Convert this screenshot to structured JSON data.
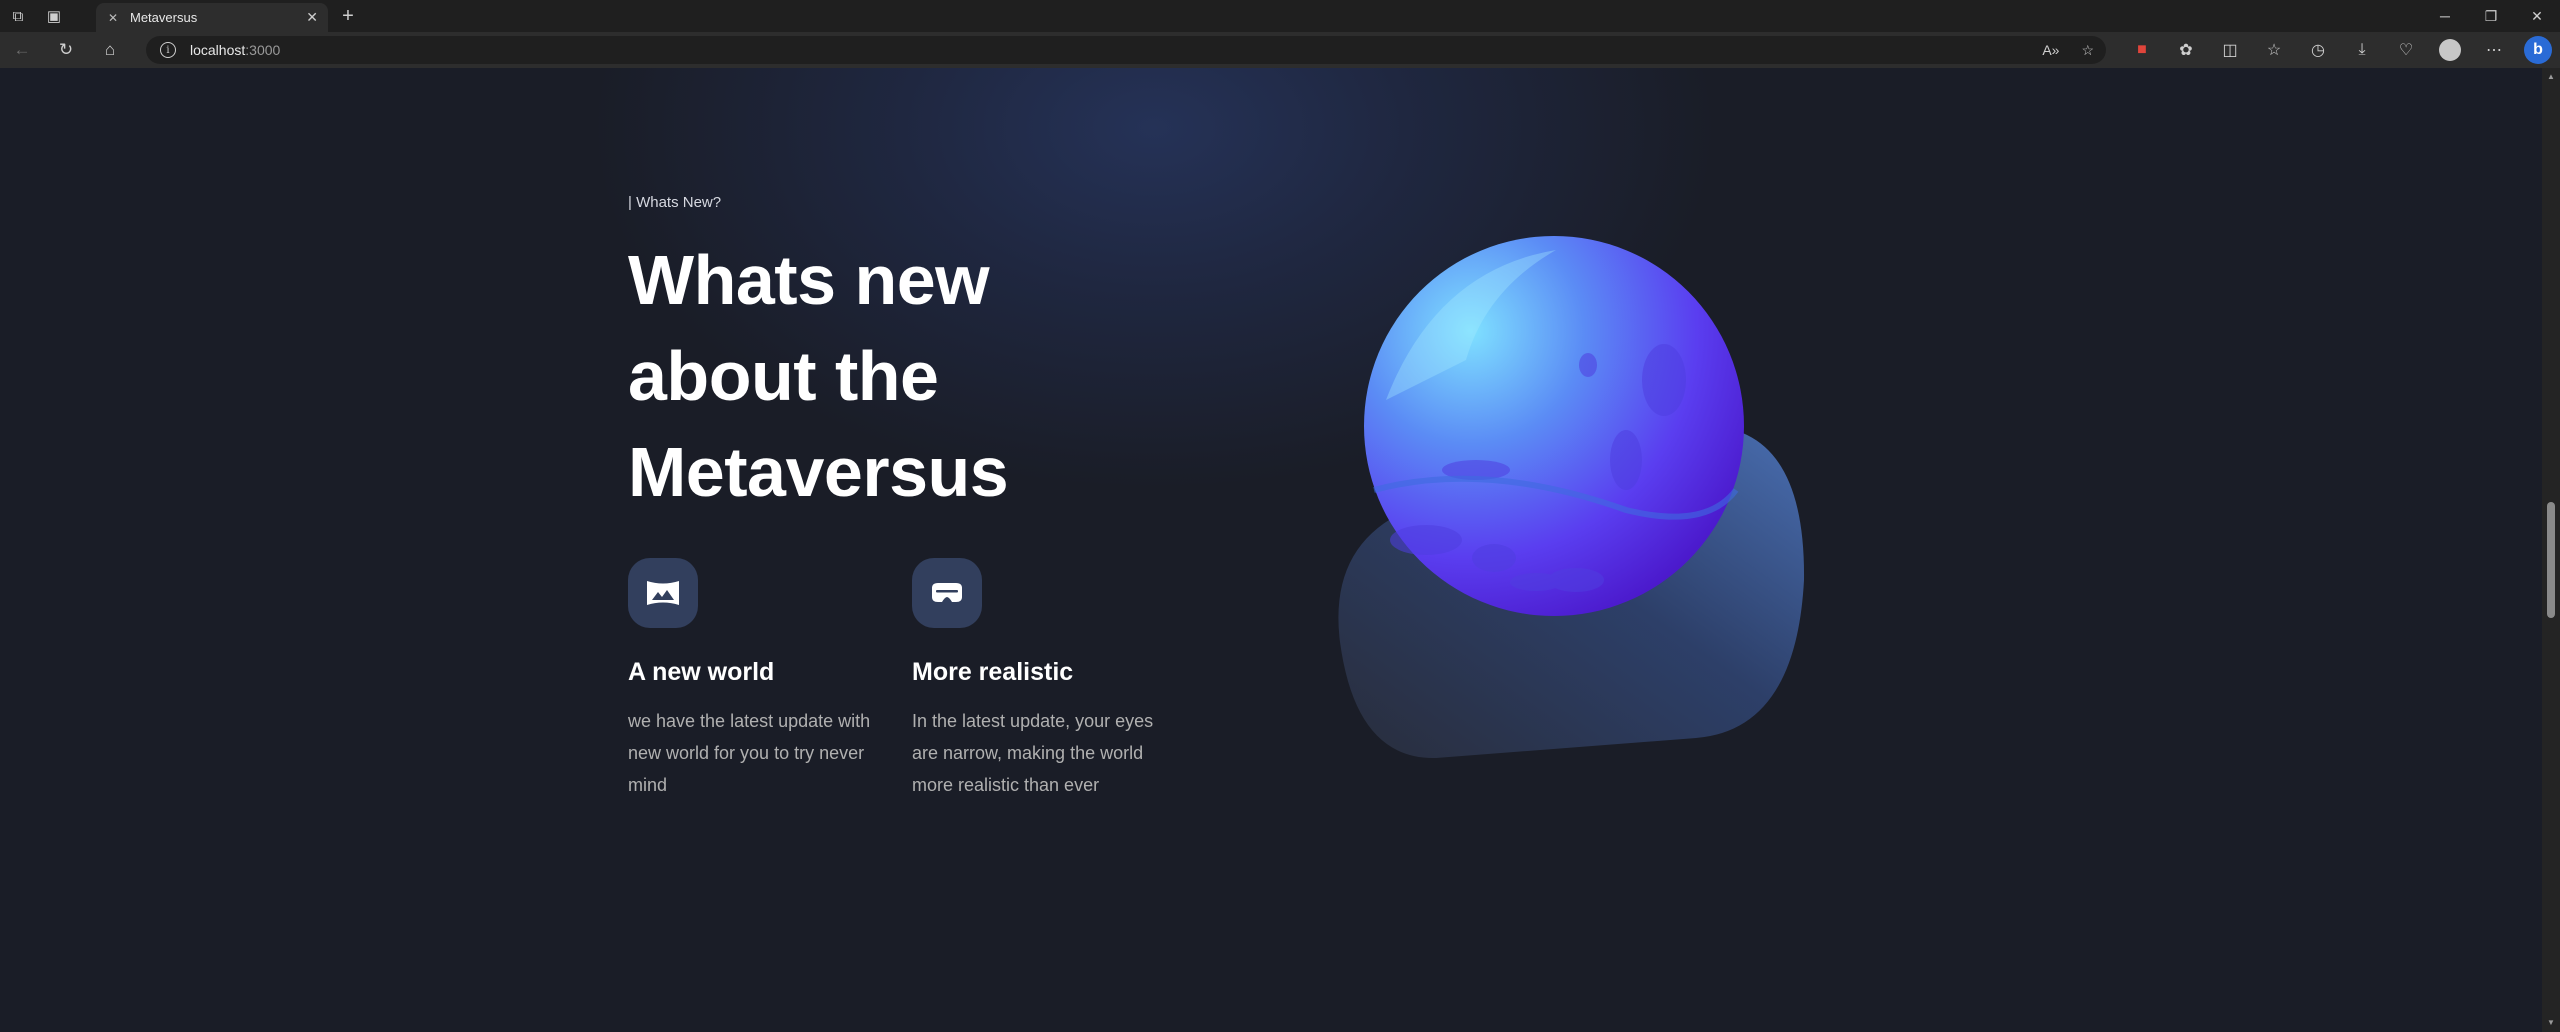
{
  "browser": {
    "tab_title": "Metaversus",
    "address_host": "localhost",
    "address_port": ":3000"
  },
  "section": {
    "eyebrow": "| Whats New?",
    "headline_line1": "Whats new",
    "headline_line2": "about the",
    "headline_line3": "Metaversus"
  },
  "features": [
    {
      "icon": "landscape-icon",
      "title": "A new world",
      "body": "we have the latest update with new world for you to try never mind"
    },
    {
      "icon": "vr-headset-icon",
      "title": "More realistic",
      "body": "In the latest update, your eyes are narrow, making the world more realistic than ever"
    }
  ],
  "colors": {
    "background": "#1a1d27",
    "icon_tile": "#323f5d",
    "planet_light": "#7dd3fc",
    "planet_dark": "#6d28d9"
  }
}
